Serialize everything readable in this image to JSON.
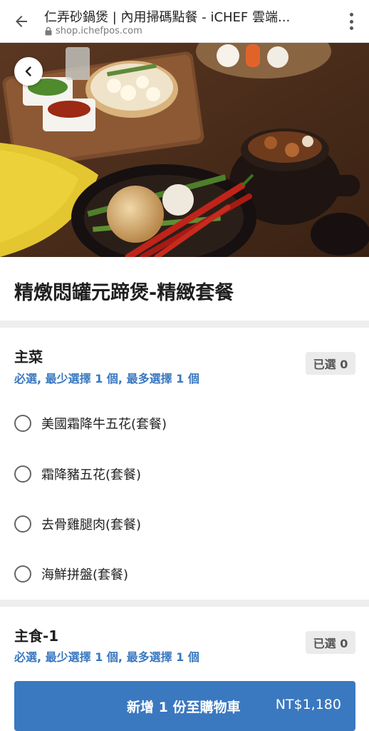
{
  "browser": {
    "title": "仁弄砂鍋煲 | 內用掃碼點餐 - iCHEF 雲端...",
    "url": "shop.ichefpos.com"
  },
  "icons": {
    "browser_back": "arrow-left-icon",
    "lock": "lock-icon",
    "menu": "more-vertical-icon",
    "hero_back": "chevron-left-icon"
  },
  "dish": {
    "title": "精燉悶罐元蹄煲-精緻套餐"
  },
  "sections": [
    {
      "title": "主菜",
      "rule": "必選, 最少選擇 1 個, 最多選擇 1 個",
      "badge": "已選 0",
      "options": [
        {
          "label": "美國霜降牛五花(套餐)"
        },
        {
          "label": "霜降豬五花(套餐)"
        },
        {
          "label": "去骨雞腿肉(套餐)"
        },
        {
          "label": "海鮮拼盤(套餐)"
        }
      ]
    },
    {
      "title": "主食-1",
      "rule": "必選, 最少選擇 1 個, 最多選擇 1 個",
      "badge": "已選 0",
      "options": []
    }
  ],
  "cart": {
    "label": "新增 1 份至購物車",
    "price": "NT$1,180"
  },
  "colors": {
    "accent": "#3a78c0",
    "badge_bg": "#ebebeb"
  }
}
